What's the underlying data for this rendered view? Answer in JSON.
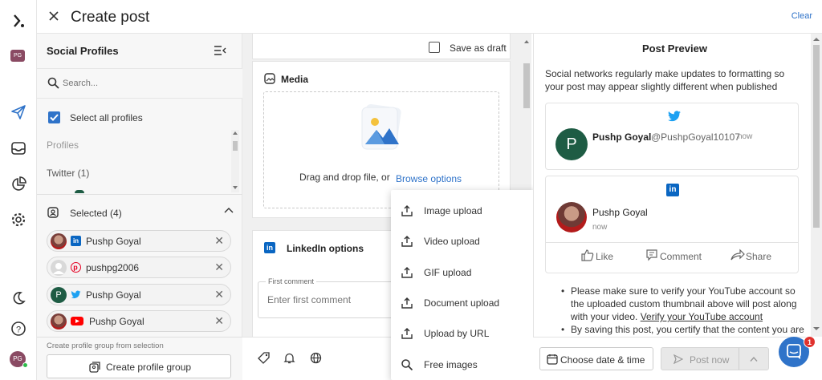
{
  "header": {
    "title": "Create post",
    "clear_label": "Clear"
  },
  "rail": {
    "avatar_initials": "PG",
    "user_initials": "PG"
  },
  "profiles": {
    "title": "Social Profiles",
    "search_placeholder": "Search...",
    "select_all_label": "Select all profiles",
    "group_heading": "Profiles",
    "twitter_group": "Twitter (1)",
    "selected_label": "Selected (4)",
    "selected": [
      {
        "name": "Pushp Goyal",
        "network": "linkedin"
      },
      {
        "name": "pushpg2006",
        "network": "pinterest"
      },
      {
        "name": "Pushp Goyal",
        "network": "twitter"
      },
      {
        "name": "Pushp Goyal",
        "network": "youtube"
      }
    ],
    "twitter_avatar_letter": "P",
    "group_hint": "Create profile group from selection",
    "create_group_label": "Create profile group"
  },
  "editor": {
    "save_draft_label": "Save as draft",
    "media_title": "Media",
    "drop_text": "Drag and drop file, or",
    "browse_label": "Browse options",
    "linkedin_options_label": "LinkedIn options",
    "first_comment_label": "First comment",
    "first_comment_placeholder": "Enter first comment"
  },
  "upload_menu": [
    {
      "label": "Image upload",
      "icon": "upload-icon"
    },
    {
      "label": "Video upload",
      "icon": "upload-icon"
    },
    {
      "label": "GIF upload",
      "icon": "upload-icon"
    },
    {
      "label": "Document upload",
      "icon": "upload-icon"
    },
    {
      "label": "Upload by URL",
      "icon": "upload-icon"
    },
    {
      "label": "Free images",
      "icon": "search-icon"
    }
  ],
  "preview": {
    "title": "Post Preview",
    "note": "Social networks regularly make updates to formatting so your post may appear slightly different when published",
    "twitter": {
      "name": "Pushp Goyal",
      "handle": "@PushpGoyal10107",
      "time": "now",
      "avatar_letter": "P"
    },
    "linkedin": {
      "name": "Pushp Goyal",
      "time": "now",
      "like": "Like",
      "comment": "Comment",
      "share": "Share"
    },
    "bullets": [
      {
        "text": "Please make sure to verify your YouTube account so the uploaded custom thumbnail above will post along with your video. ",
        "link": "Verify your YouTube account"
      },
      {
        "text": "By saving this post, you certify that the content you are",
        "link": ""
      }
    ],
    "choose_date_label": "Choose date & time",
    "post_now_label": "Post now",
    "notification_count": "1"
  },
  "colors": {
    "accent": "#2f73c9",
    "twitter": "#1da1f2",
    "linkedin": "#0a66c2",
    "pinterest": "#e60023",
    "youtube": "#ff0000",
    "avatar_green": "#1e5c44"
  }
}
